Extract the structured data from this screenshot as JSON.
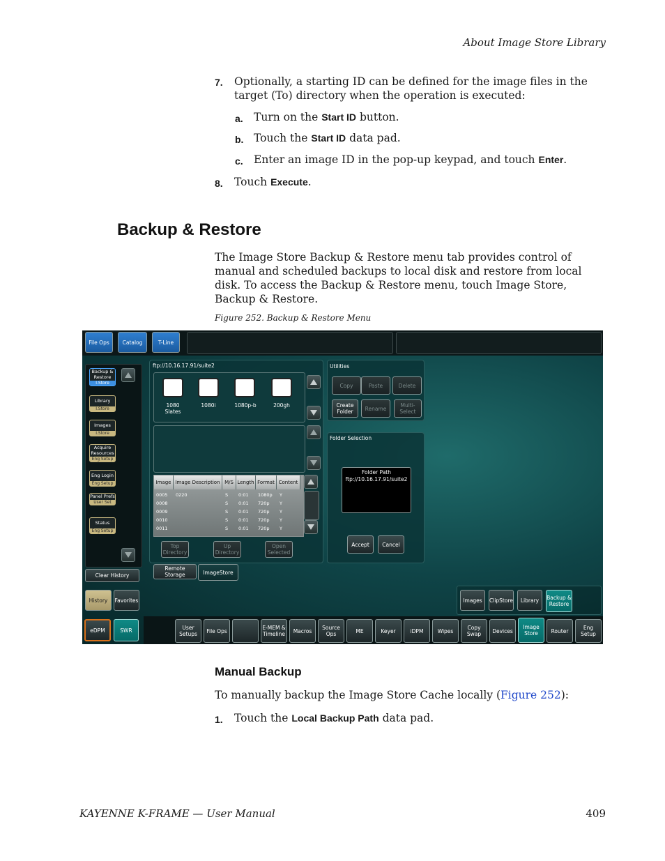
{
  "running_head": "About Image Store Library",
  "steps": {
    "s7": {
      "num": "7.",
      "text": "Optionally, a starting ID can be defined for the image files in the target (To) directory when the operation is executed:"
    },
    "a": {
      "num": "a.",
      "pre": "Turn on the",
      "kw": "Start ID",
      "post": "button."
    },
    "b": {
      "num": "b.",
      "pre": "Touch the",
      "kw": "Start ID",
      "post": "data pad."
    },
    "c": {
      "num": "c.",
      "pre": "Enter an image ID in the pop-up keypad, and touch",
      "kw": "Enter",
      "post": "."
    },
    "s8": {
      "num": "8.",
      "pre": "Touch",
      "kw": "Execute",
      "post": "."
    }
  },
  "section_title": "Backup & Restore",
  "section_body": "The Image Store Backup & Restore menu tab provides control of manual and scheduled backups to local disk and restore from local disk. To access the Backup & Restore menu, touch Image Store, Backup & Restore.",
  "figure_caption": "Figure 252.  Backup & Restore Menu",
  "ui": {
    "top_tabs": [
      "File Ops",
      "Catalog",
      "T-Line"
    ],
    "side_items": [
      {
        "label": "Backup & Restore",
        "sub": "I.Store"
      },
      {
        "label": "Library",
        "sub": "I.Store"
      },
      {
        "label": "Images",
        "sub": "I.Store"
      },
      {
        "label": "Acquire Resources",
        "sub": "Eng  Setup"
      },
      {
        "label": "Eng Login",
        "sub": "Eng  Setup"
      },
      {
        "label": "Panel Prefs",
        "sub": "User Set"
      },
      {
        "label": "Status",
        "sub": "Eng  Setup"
      }
    ],
    "clear_history": "Clear History",
    "history": "History",
    "favorites": "Favorites",
    "edpm": "eDPM",
    "swr": "SWR",
    "path": "ftp://10.16.17.91/suite2",
    "folders": [
      {
        "name": "1080 Slates"
      },
      {
        "name": "1080i"
      },
      {
        "name": "1080p-b"
      },
      {
        "name": "200gh"
      }
    ],
    "table_headers": [
      "Image",
      "Image Description",
      "M/S",
      "Length",
      "Format",
      "Content"
    ],
    "table_rows": [
      [
        "0005",
        "0220",
        "S",
        "0:01",
        "1080p",
        "Y"
      ],
      [
        "0008",
        "",
        "S",
        "0:01",
        "720p",
        "Y"
      ],
      [
        "0009",
        "",
        "S",
        "0:01",
        "720p",
        "Y"
      ],
      [
        "0010",
        "",
        "S",
        "0:01",
        "720p",
        "Y"
      ],
      [
        "0011",
        "",
        "S",
        "0:01",
        "720p",
        "Y"
      ]
    ],
    "nav_buttons": [
      "Top Directory",
      "Up Directory",
      "Open Selected"
    ],
    "storage_tabs": [
      "Remote Storage",
      "ImageStore"
    ],
    "utilities_title": "Utilities",
    "utilities": [
      "Copy",
      "Paste",
      "Delete",
      "Create Folder",
      "Rename",
      "Multi-Select"
    ],
    "folder_selection_title": "Folder Selection",
    "folder_path_label": "Folder Path",
    "folder_path_value": "ftp://10.16.17.91/suite2",
    "accept": "Accept",
    "cancel": "Cancel",
    "sub_tabs": [
      "Images",
      "ClipStore",
      "Library",
      "Backup & Restore"
    ],
    "bottom_tabs": [
      "User Setups",
      "File Ops",
      "",
      "E-MEM & Timeline",
      "Macros",
      "Source Ops",
      "ME",
      "Keyer",
      "iDPM",
      "Wipes",
      "Copy Swap",
      "Devices",
      "Image Store",
      "Router",
      "Eng Setup"
    ]
  },
  "subsection_title": "Manual Backup",
  "manual_intro": {
    "pre": "To manually backup the Image Store Cache locally (",
    "link": "Figure 252",
    "post": "):"
  },
  "step1": {
    "num": "1.",
    "pre": "Touch the",
    "kw": "Local Backup Path",
    "post": "data pad."
  },
  "footer": {
    "left": "KAYENNE K-FRAME  —  User Manual",
    "page": "409"
  }
}
